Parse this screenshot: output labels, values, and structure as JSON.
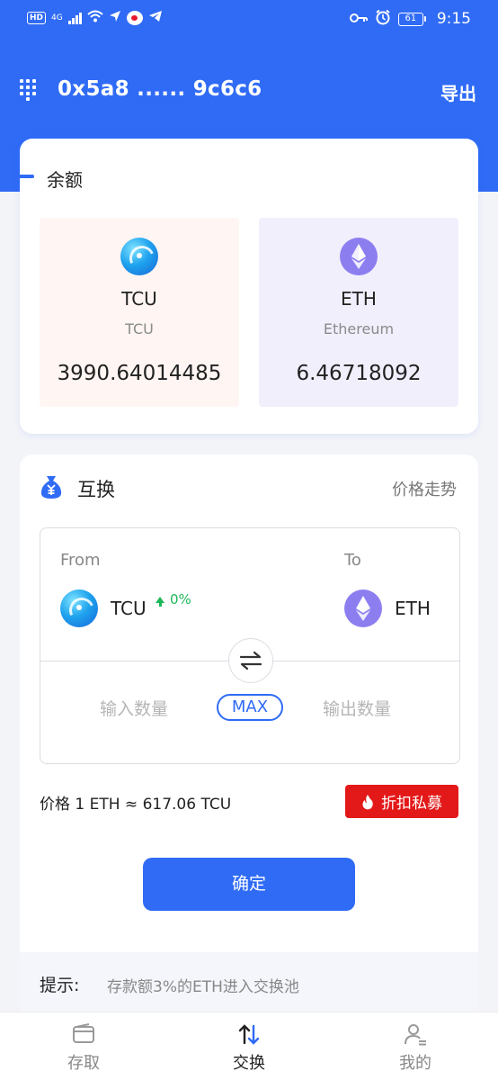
{
  "status_bar": {
    "hd": "HD",
    "network": "4G",
    "battery": "61",
    "time": "9:15"
  },
  "header": {
    "address": "0x5a8 ...... 9c6c6",
    "export_label": "导出",
    "menu_icon": "grid-icon"
  },
  "balance": {
    "title": "余额",
    "assets": [
      {
        "symbol": "TCU",
        "name": "TCU",
        "balance": "3990.64014485",
        "icon": "tcu-icon"
      },
      {
        "symbol": "ETH",
        "name": "Ethereum",
        "balance": "6.46718092",
        "icon": "eth-icon"
      }
    ]
  },
  "swap": {
    "title": "互换",
    "trend_link": "价格走势",
    "from_label": "From",
    "to_label": "To",
    "from_token": "TCU",
    "from_change": "0%",
    "to_token": "ETH",
    "input_placeholder": "输入数量",
    "max_label": "MAX",
    "output_placeholder": "输出数量",
    "price": "价格 1 ETH ≈ 617.06 TCU",
    "discount_label": "折扣私募",
    "confirm_label": "确定",
    "tip_label": "提示:",
    "tip_text": "存款额3%的ETH进入交换池"
  },
  "colors": {
    "brand": "#2f6bf5",
    "discount": "#e31818",
    "positive": "#1eb85a"
  },
  "nav": {
    "items": [
      {
        "label": "存取",
        "icon": "wallet-icon",
        "active": false
      },
      {
        "label": "交换",
        "icon": "exchange-icon",
        "active": true
      },
      {
        "label": "我的",
        "icon": "user-icon",
        "active": false
      }
    ]
  }
}
